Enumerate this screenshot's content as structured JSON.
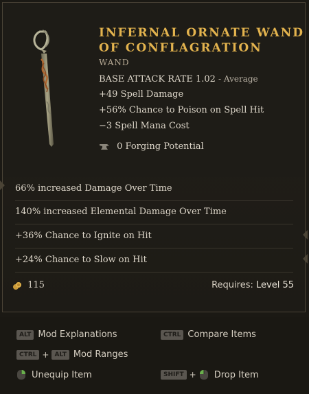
{
  "item": {
    "name": "Infernal Ornate Wand of Conflagration",
    "type": "Wand",
    "base_attack_rate_label": "BASE ATTACK RATE 1.02",
    "base_attack_rate_note": "- Average",
    "stats": [
      "+49 Spell Damage",
      "+56% Chance to Poison on Spell Hit",
      "−3 Spell Mana Cost"
    ],
    "forging": "0 Forging Potential"
  },
  "affixes": [
    "66% increased Damage Over Time",
    "140% increased Elemental Damage Over Time",
    "+36% Chance to Ignite on Hit",
    "+24% Chance to Slow on Hit"
  ],
  "footer": {
    "gold": "115",
    "requires_label": "Requires:",
    "requires_value": "Level 55"
  },
  "controls": {
    "mod_explanations": {
      "key": "ALT",
      "label": "Mod Explanations"
    },
    "compare_items": {
      "key": "CTRL",
      "label": "Compare Items"
    },
    "mod_ranges": {
      "key1": "CTRL",
      "key2": "ALT",
      "plus": "+",
      "label": "Mod Ranges"
    },
    "unequip_item": {
      "label": "Unequip Item"
    },
    "drop_item": {
      "key": "SHIFT",
      "plus": "+",
      "label": "Drop Item"
    }
  },
  "colors": {
    "item_name": "#e3b34e",
    "text": "#ddd6c9",
    "background": "#1b1914"
  }
}
